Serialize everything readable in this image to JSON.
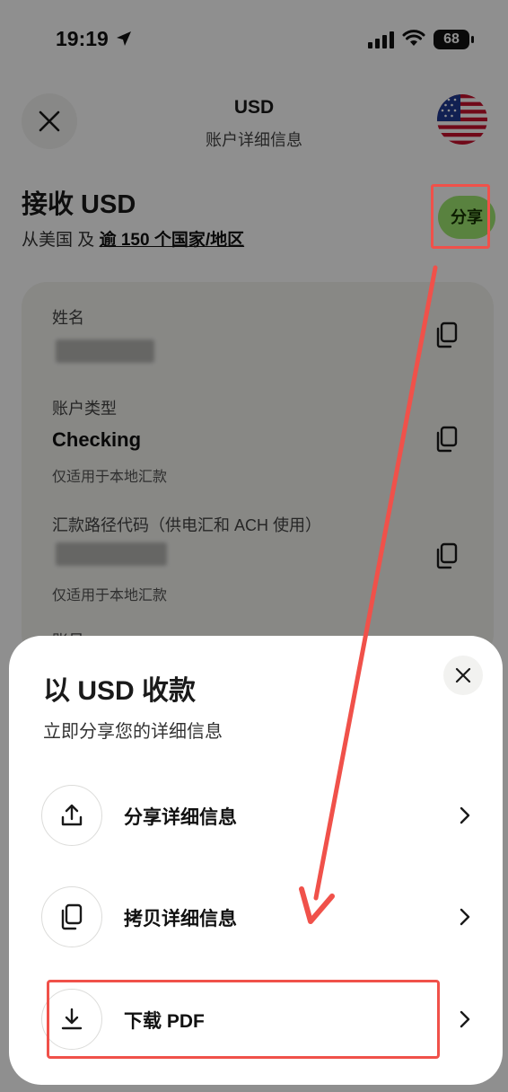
{
  "status_bar": {
    "time": "19:19",
    "battery": "68"
  },
  "header": {
    "title": "USD",
    "subtitle": "账户详细信息"
  },
  "receive": {
    "title": "接收 USD",
    "sub_prefix": "从美国 及",
    "sub_link": "逾 150 个国家/地区",
    "share_label": "分享"
  },
  "details": {
    "name_label": "姓名",
    "account_type_label": "账户类型",
    "account_type_value": "Checking",
    "account_type_note": "仅适用于本地汇款",
    "routing_label": "汇款路径代码（供电汇和 ACH 使用）",
    "routing_note": "仅适用于本地汇款",
    "account_number_label": "账号"
  },
  "sheet": {
    "title": "以 USD 收款",
    "subtitle": "立即分享您的详细信息",
    "options": [
      {
        "label": "分享详细信息",
        "icon": "share-upload-icon"
      },
      {
        "label": "拷贝详细信息",
        "icon": "copy-icon"
      },
      {
        "label": "下载 PDF",
        "icon": "download-icon"
      }
    ]
  },
  "colors": {
    "accent_green": "#9fe870",
    "annotation_red": "#f0514a"
  }
}
